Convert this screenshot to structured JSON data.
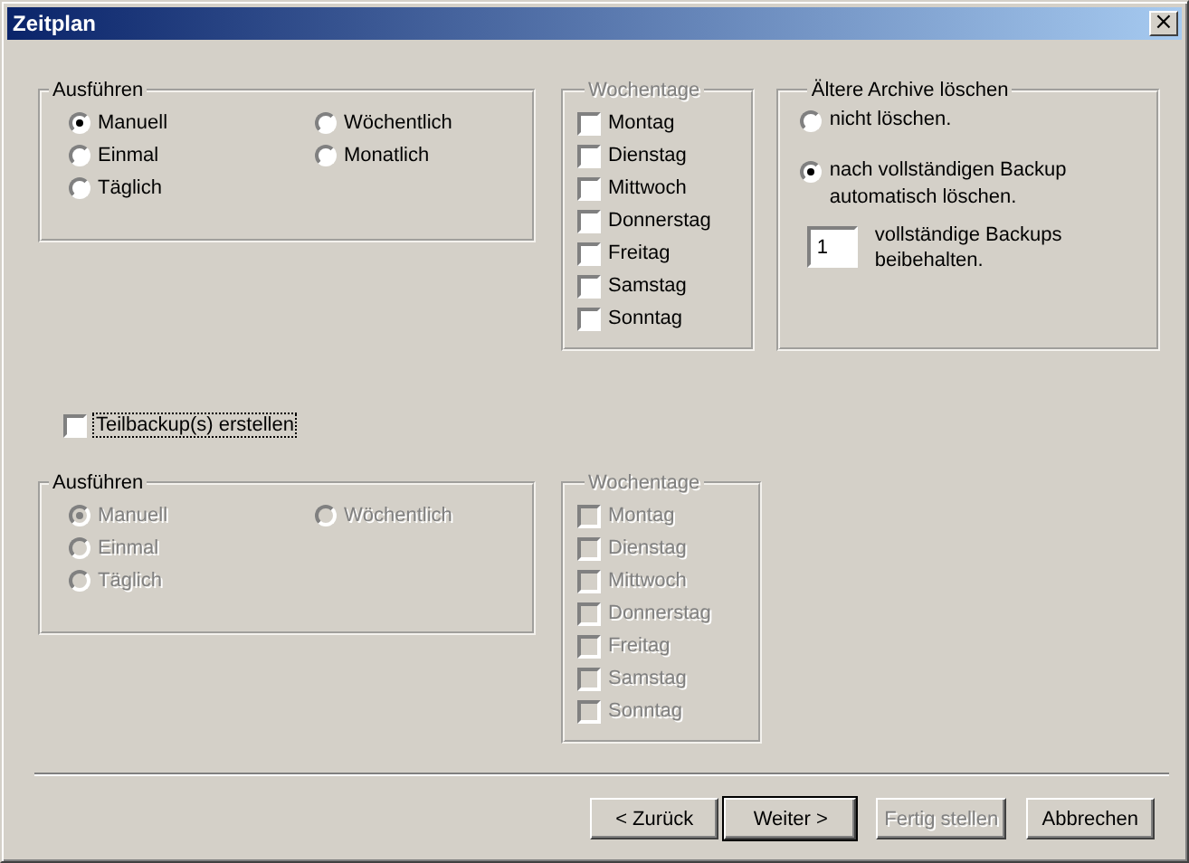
{
  "window": {
    "title": "Zeitplan",
    "close": "×"
  },
  "full_backup": {
    "schedule": {
      "title": "Ausführen",
      "disabled": false,
      "options": [
        {
          "label": "Manuell",
          "selected": true
        },
        {
          "label": "Einmal",
          "selected": false
        },
        {
          "label": "Täglich",
          "selected": false
        },
        {
          "label": "Wöchentlich",
          "selected": false
        },
        {
          "label": "Monatlich",
          "selected": false
        }
      ]
    },
    "weekdays": {
      "title": "Wochentage",
      "title_disabled": true,
      "disabled": false,
      "days": [
        {
          "label": "Montag",
          "checked": false
        },
        {
          "label": "Dienstag",
          "checked": false
        },
        {
          "label": "Mittwoch",
          "checked": false
        },
        {
          "label": "Donnerstag",
          "checked": false
        },
        {
          "label": "Freitag",
          "checked": false
        },
        {
          "label": "Samstag",
          "checked": false
        },
        {
          "label": "Sonntag",
          "checked": false
        }
      ]
    },
    "archive": {
      "title": "Ältere Archive löschen",
      "options": [
        {
          "label": "nicht löschen.",
          "selected": false
        },
        {
          "label": "nach vollständigen Backup automatisch löschen.",
          "selected": true
        }
      ],
      "keep_value": "1",
      "keep_label": "vollständige Backups beibehalten."
    }
  },
  "partial_backup": {
    "label": "Teilbackup(s) erstellen",
    "checked": false,
    "focused": true,
    "schedule": {
      "title": "Ausführen",
      "disabled": true,
      "options": [
        {
          "label": "Manuell",
          "selected": true
        },
        {
          "label": "Einmal",
          "selected": false
        },
        {
          "label": "Täglich",
          "selected": false
        },
        {
          "label": "Wöchentlich",
          "selected": false
        }
      ]
    },
    "weekdays": {
      "title": "Wochentage",
      "title_disabled": true,
      "disabled": true,
      "days": [
        {
          "label": "Montag",
          "checked": false
        },
        {
          "label": "Dienstag",
          "checked": false
        },
        {
          "label": "Mittwoch",
          "checked": false
        },
        {
          "label": "Donnerstag",
          "checked": false
        },
        {
          "label": "Freitag",
          "checked": false
        },
        {
          "label": "Samstag",
          "checked": false
        },
        {
          "label": "Sonntag",
          "checked": false
        }
      ]
    }
  },
  "buttons": [
    {
      "label": "< Zurück",
      "disabled": false,
      "default": false
    },
    {
      "label": "Weiter >",
      "disabled": false,
      "default": true
    },
    {
      "label": "Fertig stellen",
      "disabled": true,
      "default": false
    },
    {
      "label": "Abbrechen",
      "disabled": false,
      "default": false
    }
  ]
}
